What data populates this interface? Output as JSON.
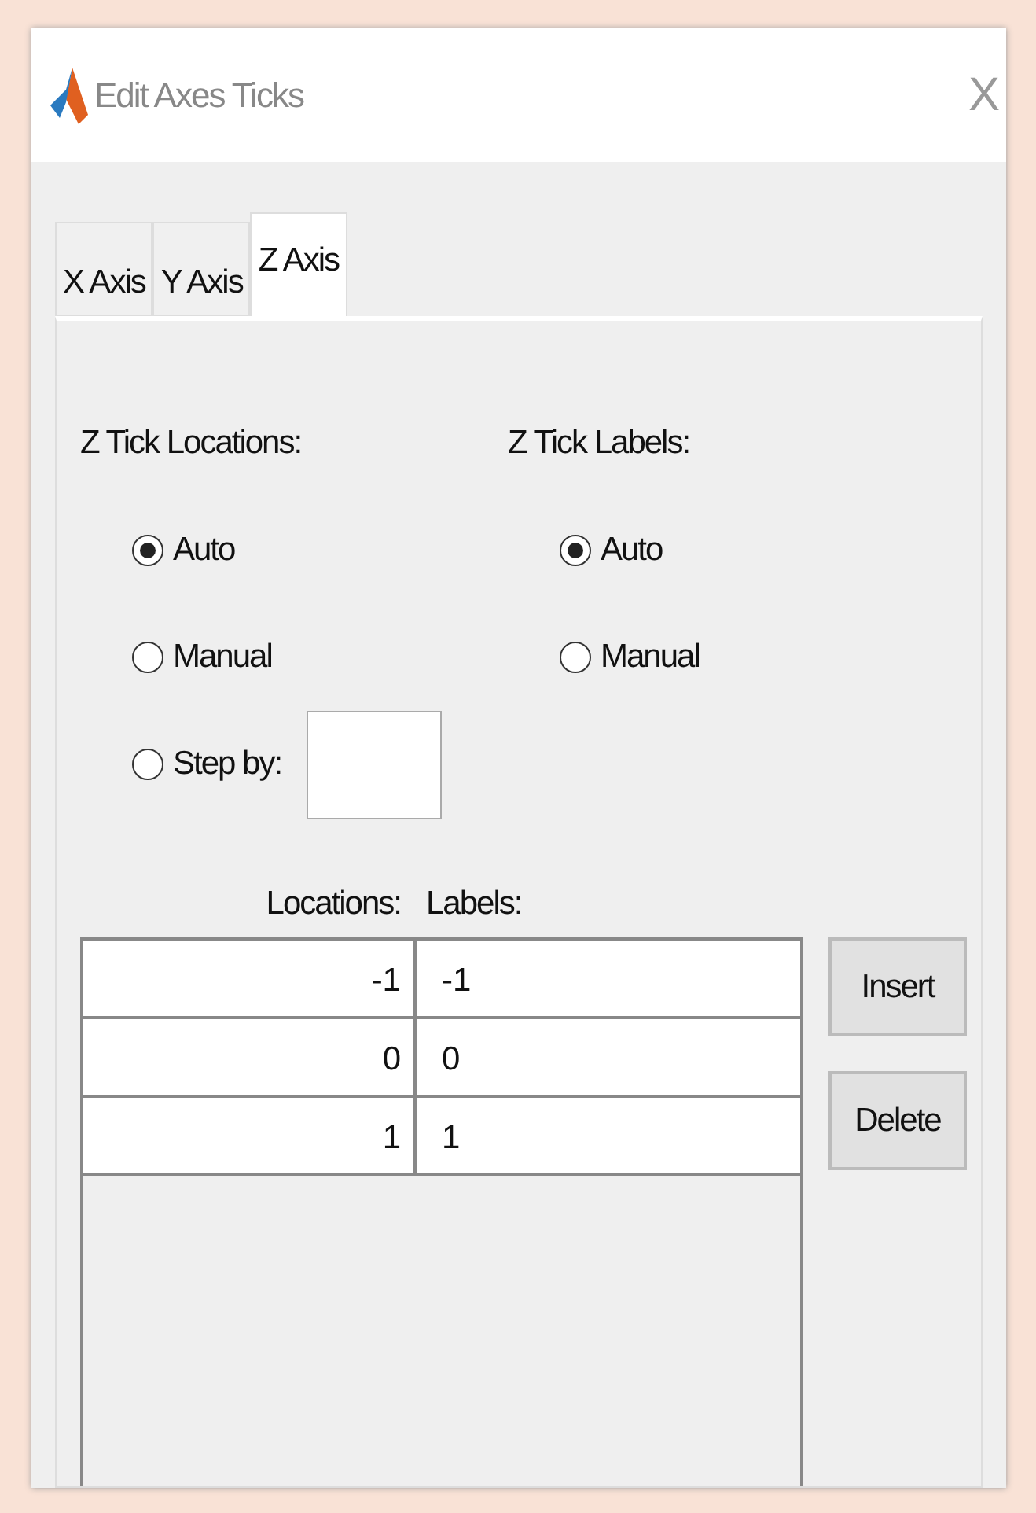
{
  "window": {
    "title": "Edit Axes Ticks",
    "close": "X"
  },
  "tabs": [
    {
      "label": "X Axis",
      "selected": false
    },
    {
      "label": "Y Axis",
      "selected": false
    },
    {
      "label": "Z Axis",
      "selected": true
    }
  ],
  "tick_locations": {
    "heading": "Z Tick Locations:",
    "options": [
      {
        "label": "Auto",
        "selected": true,
        "kind": "plain"
      },
      {
        "label": "Manual",
        "selected": false,
        "kind": "plain"
      },
      {
        "label": "Step by:",
        "selected": false,
        "kind": "field"
      }
    ]
  },
  "tick_labels": {
    "heading": "Z Tick Labels:",
    "options": [
      {
        "label": "Auto",
        "selected": true,
        "kind": "plain"
      },
      {
        "label": "Manual",
        "selected": false,
        "kind": "plain"
      }
    ]
  },
  "table": {
    "columns": [
      "Locations:",
      "Labels:"
    ],
    "rows": [
      {
        "location": "-1",
        "label": "-1"
      },
      {
        "location": "0",
        "label": "0"
      },
      {
        "location": "1",
        "label": "1"
      }
    ]
  },
  "buttons": [
    "Insert",
    "Delete"
  ]
}
